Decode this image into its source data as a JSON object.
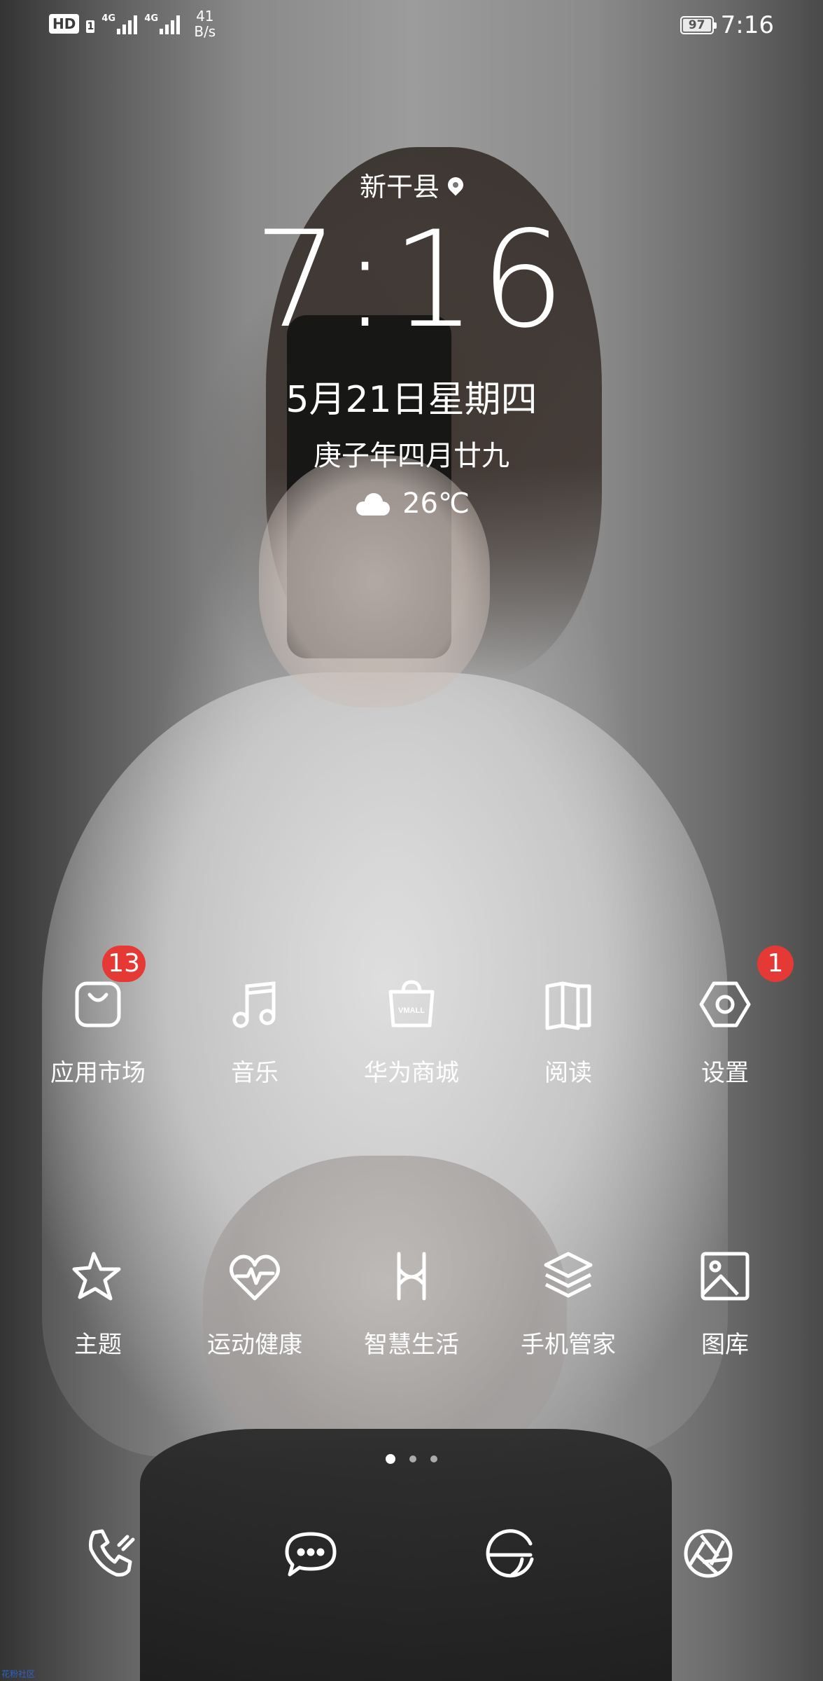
{
  "status_bar": {
    "hd": "HD",
    "sim": "1",
    "signal1_label": "4G",
    "signal2_label": "4G",
    "speed_value": "41",
    "speed_unit": "B/s",
    "battery": "97",
    "time": "7:16"
  },
  "lock": {
    "location": "新干县",
    "clock": "7:16",
    "date": "5月21日星期四",
    "lunar": "庚子年四月廿九",
    "temperature": "26℃"
  },
  "apps_row1": [
    {
      "label": "应用市场",
      "badge": "13",
      "icon": "shopping-bag-icon"
    },
    {
      "label": "音乐",
      "icon": "music-note-icon"
    },
    {
      "label": "华为商城",
      "icon": "vmall-bag-icon",
      "icon_text": "VMALL"
    },
    {
      "label": "阅读",
      "icon": "book-icon"
    },
    {
      "label": "设置",
      "badge": "1",
      "icon": "gear-icon"
    }
  ],
  "apps_row2": [
    {
      "label": "主题",
      "icon": "theme-star-icon"
    },
    {
      "label": "运动健康",
      "icon": "heart-pulse-icon"
    },
    {
      "label": "智慧生活",
      "icon": "smart-life-icon"
    },
    {
      "label": "手机管家",
      "icon": "layers-icon"
    },
    {
      "label": "图库",
      "icon": "gallery-icon"
    }
  ],
  "page_indicator": {
    "pages": 3,
    "active": 1
  },
  "dock": [
    {
      "icon": "phone-icon"
    },
    {
      "icon": "messages-icon"
    },
    {
      "icon": "browser-icon"
    },
    {
      "icon": "camera-icon"
    }
  ],
  "watermark": "花粉社区",
  "colors": {
    "badge": "#e53935",
    "text": "#ffffff"
  }
}
